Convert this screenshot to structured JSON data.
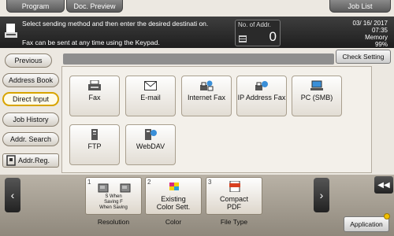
{
  "tabs": {
    "program": "Program",
    "doc_preview": "Doc. Preview",
    "job_list": "Job List"
  },
  "banner": {
    "message": "Select sending method and then enter the desired destinati on.",
    "message2": "Fax can be sent at any time using the Keypad.",
    "addr_label": "No. of Addr.",
    "addr_count": "0",
    "date": "03/ 16/ 2017",
    "time": "07:35",
    "memory_label": "Memory",
    "memory_value": "99%"
  },
  "sidebar": {
    "previous": "Previous",
    "address_book": "Address Book",
    "direct_input": "Direct Input",
    "job_history": "Job History",
    "addr_search": "Addr. Search",
    "addr_reg": "Addr.Reg."
  },
  "check_setting": "Check Setting",
  "destinations": [
    {
      "label": "Fax",
      "icon": "fax-icon"
    },
    {
      "label": "E-mail",
      "icon": "email-icon"
    },
    {
      "label": "Internet Fax",
      "icon": "internet-fax-icon"
    },
    {
      "label": "IP Address Fax",
      "icon": "ip-address-fax-icon"
    },
    {
      "label": "PC (SMB)",
      "icon": "pc-smb-icon"
    },
    {
      "label": "FTP",
      "icon": "ftp-icon"
    },
    {
      "label": "WebDAV",
      "icon": "webdav-icon"
    }
  ],
  "functions": [
    {
      "num": "1",
      "text": "S When Saving F When Saving",
      "caption": "Resolution"
    },
    {
      "num": "2",
      "text": "Existing Color Sett.",
      "caption": "Color"
    },
    {
      "num": "3",
      "text": "Compact PDF",
      "caption": "File Type"
    }
  ],
  "application": "Application",
  "colors": {
    "active_border": "#d8a400",
    "banner_bg": "#1e1e1e"
  }
}
